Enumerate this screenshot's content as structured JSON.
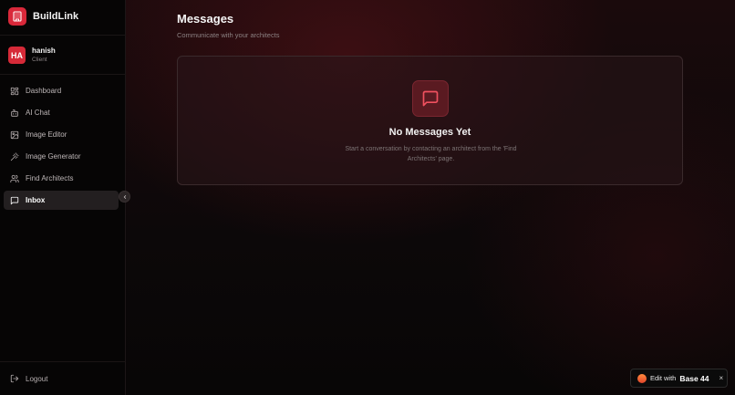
{
  "brand": {
    "name": "BuildLink"
  },
  "user": {
    "initials": "HA",
    "name": "hanish",
    "role": "Client"
  },
  "nav": {
    "items": [
      {
        "label": "Dashboard",
        "icon": "dashboard-icon",
        "active": false
      },
      {
        "label": "AI Chat",
        "icon": "bot-icon",
        "active": false
      },
      {
        "label": "Image Editor",
        "icon": "image-icon",
        "active": false
      },
      {
        "label": "Image Generator",
        "icon": "wand-icon",
        "active": false
      },
      {
        "label": "Find Architects",
        "icon": "users-icon",
        "active": false
      },
      {
        "label": "Inbox",
        "icon": "message-icon",
        "active": true
      }
    ],
    "logout_label": "Logout"
  },
  "page": {
    "title": "Messages",
    "subtitle": "Communicate with your architects"
  },
  "empty_state": {
    "icon": "message-square-icon",
    "title": "No Messages Yet",
    "description": "Start a conversation by contacting an architect from the 'Find Architects' page."
  },
  "badge": {
    "prefix": "Edit with",
    "brand": "Base 44",
    "close": "×"
  },
  "colors": {
    "accent": "#d9283a",
    "background": "#0a0708",
    "sidebar": "#060505",
    "active_item": "#231f20"
  }
}
